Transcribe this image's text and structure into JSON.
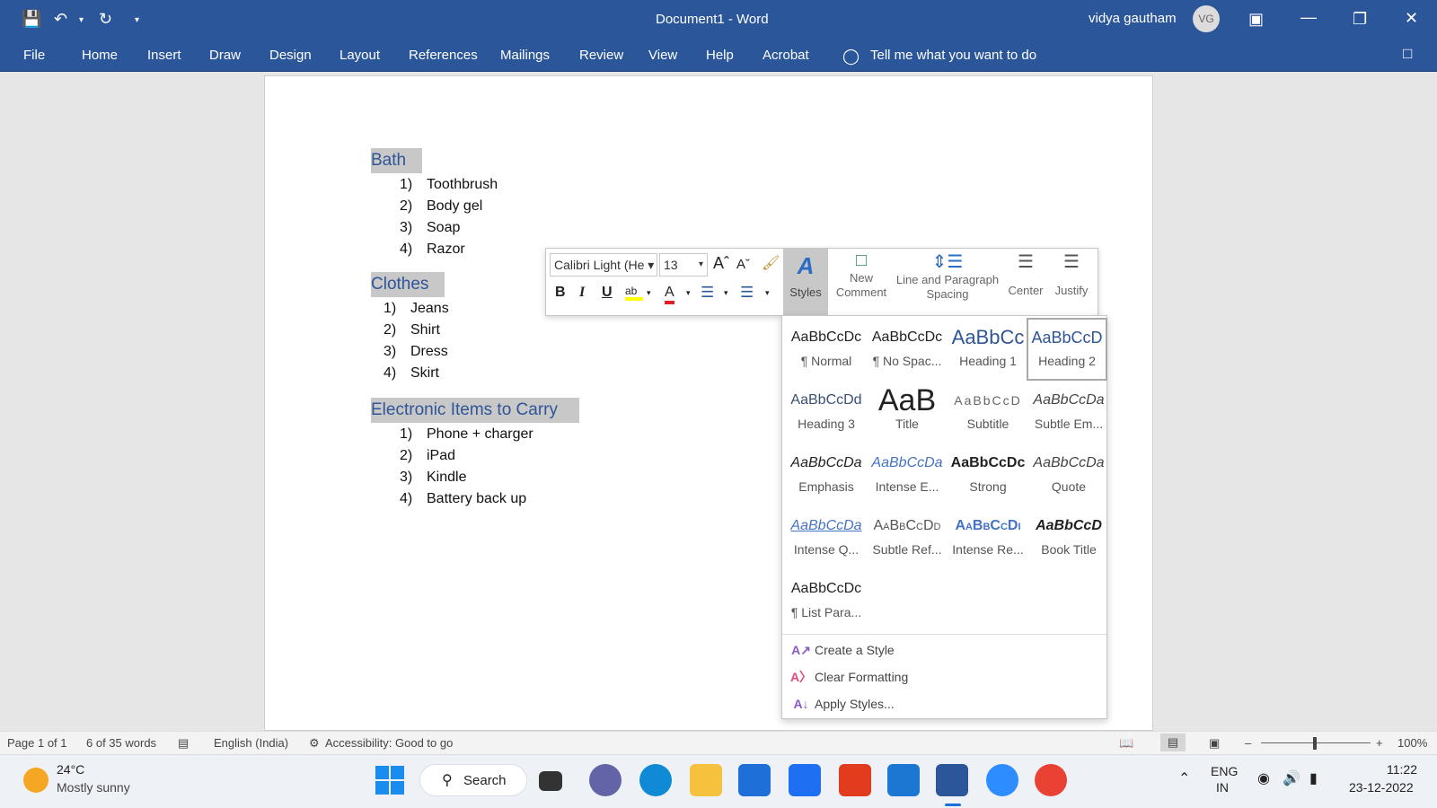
{
  "window": {
    "title": "Document1 - Word",
    "user": "vidya gautham",
    "avatar": "VG"
  },
  "menu": [
    "File",
    "Home",
    "Insert",
    "Draw",
    "Design",
    "Layout",
    "References",
    "Mailings",
    "Review",
    "View",
    "Help",
    "Acrobat"
  ],
  "tell_me": "Tell me what you want to do",
  "document": {
    "sections": [
      {
        "heading": "Bath",
        "items": [
          {
            "num": "1)",
            "text": "Toothbrush"
          },
          {
            "num": "2)",
            "text": "Body gel"
          },
          {
            "num": "3)",
            "text": "Soap"
          },
          {
            "num": "4)",
            "text": "Razor"
          }
        ]
      },
      {
        "heading": "Clothes",
        "items": [
          {
            "num": "1)",
            "text": "Jeans"
          },
          {
            "num": "2)",
            "text": "Shirt"
          },
          {
            "num": "3)",
            "text": "Dress"
          },
          {
            "num": "4)",
            "text": "Skirt"
          }
        ]
      },
      {
        "heading": "Electronic Items to Carry",
        "items": [
          {
            "num": "1)",
            "text": "Phone + charger"
          },
          {
            "num": "2)",
            "text": "iPad"
          },
          {
            "num": "3)",
            "text": "Kindle"
          },
          {
            "num": "4)",
            "text": "Battery back up"
          }
        ]
      }
    ]
  },
  "minibar": {
    "font": "Calibri Light (He",
    "size": "13",
    "styles": "Styles",
    "new_comment": [
      "New",
      "Comment"
    ],
    "line_spacing": [
      "Line and Paragraph",
      "Spacing"
    ],
    "center": "Center",
    "justify": "Justify",
    "bold": "B",
    "italic": "I",
    "underline": "U"
  },
  "styles": [
    {
      "preview": "AaBbCcDc",
      "name": "¶ Normal"
    },
    {
      "preview": "AaBbCcDc",
      "name": "¶ No Spac..."
    },
    {
      "preview": "AaBbCc",
      "name": "Heading 1"
    },
    {
      "preview": "AaBbCcD",
      "name": "Heading 2"
    },
    {
      "preview": "AaBbCcDd",
      "name": "Heading 3"
    },
    {
      "preview": "AaB",
      "name": "Title"
    },
    {
      "preview": "AaBbCcD",
      "name": "Subtitle"
    },
    {
      "preview": "AaBbCcDa",
      "name": "Subtle Em..."
    },
    {
      "preview": "AaBbCcDa",
      "name": "Emphasis"
    },
    {
      "preview": "AaBbCcDa",
      "name": "Intense E..."
    },
    {
      "preview": "AaBbCcDc",
      "name": "Strong"
    },
    {
      "preview": "AaBbCcDa",
      "name": "Quote"
    },
    {
      "preview": "AaBbCcDa",
      "name": "Intense Q..."
    },
    {
      "preview": "AaBbCcDd",
      "name": "Subtle Ref..."
    },
    {
      "preview": "AaBbCcDi",
      "name": "Intense Re..."
    },
    {
      "preview": "AaBbCcD",
      "name": "Book Title"
    },
    {
      "preview": "AaBbCcDc",
      "name": "¶ List Para..."
    }
  ],
  "style_actions": [
    "Create a Style",
    "Clear Formatting",
    "Apply Styles..."
  ],
  "status": {
    "page": "Page 1 of 1",
    "words": "6 of 35 words",
    "lang": "English (India)",
    "access": "Accessibility: Good to go",
    "zoom": "100%"
  },
  "taskbar": {
    "temp": "24°C",
    "weather": "Mostly sunny",
    "search": "Search",
    "lang1": "ENG",
    "lang2": "IN",
    "time": "11:22",
    "date": "23-12-2022"
  },
  "colors": {
    "accent": "#2b579a",
    "heading": "#2f5597",
    "highlight": "#c8c8c8"
  }
}
